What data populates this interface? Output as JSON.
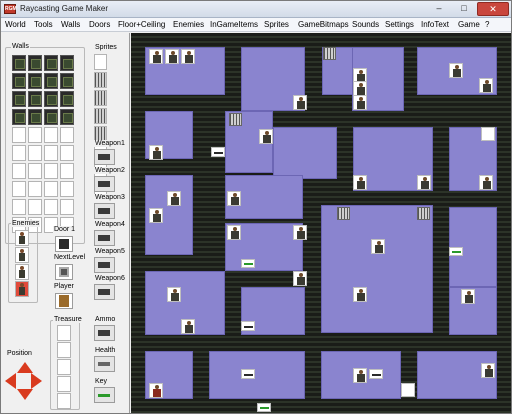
{
  "window": {
    "title": "Raycasting Game Maker",
    "icon_text": "RGM",
    "minimize": "–",
    "maximize": "□",
    "close": "✕"
  },
  "menu": [
    "World",
    "Tools",
    "Walls",
    "Doors",
    "Floor+Ceiling",
    "Enemies",
    "InGameItems",
    "Sprites",
    "GameBitmaps",
    "Sounds",
    "Settings",
    "InfoText",
    "Game",
    "?"
  ],
  "left_panel": {
    "walls_label": "Walls",
    "sprites_label": "Sprites",
    "enemies_label": "Enemies",
    "door_label": "Door 1",
    "nextlevel_label": "NextLevel",
    "player_label": "Player",
    "treasure_label": "Treasure",
    "ammo_label": "Ammo",
    "health_label": "Health",
    "key_label": "Key",
    "position_label": "Position",
    "weapons": [
      "Weapon1",
      "Weapon2",
      "Weapon3",
      "Weapon4",
      "Weapon5",
      "Weapon6"
    ]
  },
  "icons": {
    "arrows": [
      "arrow-up-icon",
      "arrow-left-icon",
      "arrow-right-icon",
      "arrow-down-icon"
    ],
    "accent": "#d93a1e",
    "map_room": "#8a84cf"
  }
}
